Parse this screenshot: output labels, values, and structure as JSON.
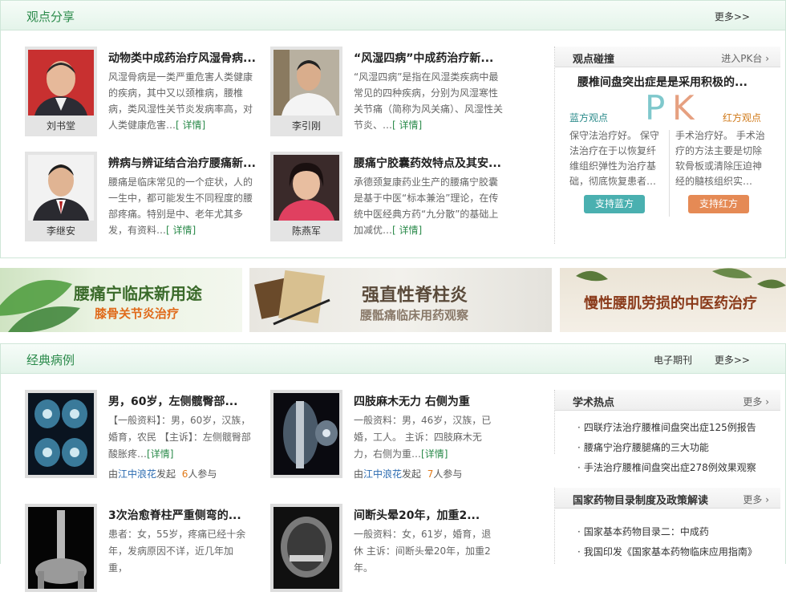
{
  "viewpoints": {
    "title": "观点分享",
    "more": "更多>>",
    "cards": [
      {
        "name": "刘书堂",
        "title": "动物类中成药治疗风湿骨病...",
        "desc": "风湿骨病是一类严重危害人类健康的疾病，其中又以颈椎病，腰椎病，类风湿性关节炎发病率高，对人类健康危害…",
        "detail": "[ 详情]"
      },
      {
        "name": "李引刚",
        "title": "“风湿四病”中成药治疗新...",
        "desc": "“风湿四病”是指在风湿类疾病中最常见的四种疾病，分别为风湿寒性关节痛（简称为风关痛）、风湿性关节炎、…",
        "detail": "[ 详情]"
      },
      {
        "name": "李继安",
        "title": "辨病与辨证结合治疗腰痛新...",
        "desc": "腰痛是临床常见的一个症状，人的一生中，都可能发生不同程度的腰部疼痛。特别是中、老年尤其多发，有资料…",
        "detail": "[ 详情]"
      },
      {
        "name": "陈燕军",
        "title": "腰痛宁胶囊药效特点及其安...",
        "desc": "承德颈复康药业生产的腰痛宁胶囊是基于中医“标本兼治”理论，在传统中医经典方药“九分散”的基础上加减优…",
        "detail": "[ 详情]"
      }
    ]
  },
  "pk": {
    "title": "观点碰撞",
    "enter": "进入PK台",
    "question": "腰椎间盘突出症是是采用积极的...",
    "p": "P",
    "k": "K",
    "blue_label": "蓝方观点",
    "red_label": "红方观点",
    "blue_text": "保守法治疗好。 保守法治疗在于以恢复纤维组织弹性为治疗基础，彻底恢复患者…",
    "red_text": "手术治疗好。 手术治疗的方法主要是切除软骨板或清除压迫神经的髓核组织实…",
    "blue_button": "支持蓝方",
    "red_button": "支持红方"
  },
  "banners": [
    {
      "line1": "腰痛宁临床新用途",
      "line2": "膝骨关节炎治疗",
      "color1": "#3a6a2a",
      "color2": "#e06a1a"
    },
    {
      "line1": "强直性脊柱炎",
      "line2": "腰骶痛临床用药观察",
      "color1": "#5a4a3a",
      "color2": "#8a7a6a"
    },
    {
      "line1": "慢性腰肌劳损的中医药治疗",
      "line2": "",
      "color1": "#8a3a1a",
      "color2": ""
    }
  ],
  "cases": {
    "title": "经典病例",
    "journal": "电子期刊",
    "more": "更多>>",
    "items": [
      {
        "title": "男，60岁，左侧髋臀部...",
        "desc": "【一般资料】：男，60岁，汉族，婚育，农民 【主诉】：左侧髋臀部酸胀疼…",
        "detail": "[详情]",
        "by": "由",
        "user": "江中浪花",
        "action": "发起",
        "count": "6",
        "join": "人参与"
      },
      {
        "title": "四肢麻木无力 右侧为重",
        "desc": "一般资料：男，46岁，汉族，已婚，工人。 主诉：四肢麻木无力，右侧为重…",
        "detail": "[详情]",
        "by": "由",
        "user": "江中浪花",
        "action": "发起",
        "count": "7",
        "join": "人参与"
      },
      {
        "title": "3次治愈脊柱严重侧弯的...",
        "desc": "患者：女，55岁，疼痛已经十余年，发病原因不详，近几年加重，",
        "detail": "",
        "by": "",
        "user": "",
        "action": "",
        "count": "",
        "join": ""
      },
      {
        "title": "间断头晕20年，加重2...",
        "desc": "一般资料：女，61岁，婚育，退休 主诉：间断头晕20年，加重2年。",
        "detail": "",
        "by": "",
        "user": "",
        "action": "",
        "count": "",
        "join": ""
      }
    ]
  },
  "hot": {
    "title": "学术热点",
    "more": "更多",
    "items": [
      "四联疗法治疗腰椎间盘突出症125例报告",
      "腰痛宁治疗腰腿痛的三大功能",
      "手法治疗腰椎间盘突出症278例效果观察"
    ]
  },
  "policy": {
    "title": "国家药物目录制度及政策解读",
    "more": "更多",
    "items": [
      "国家基本药物目录二：中成药",
      "我国印发《国家基本药物临床应用指南》"
    ]
  }
}
